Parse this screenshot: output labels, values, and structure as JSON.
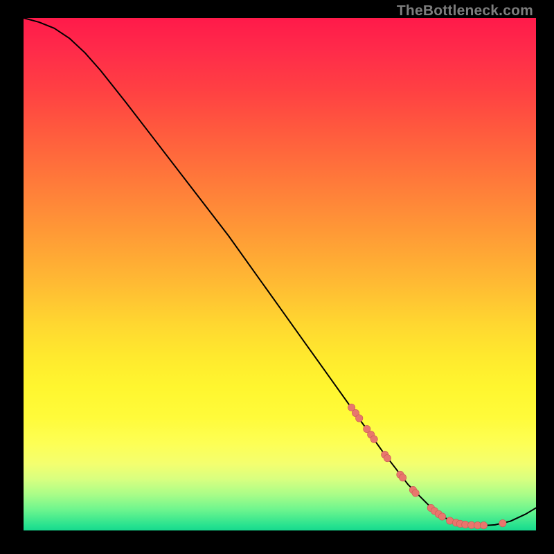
{
  "watermark": "TheBottleneck.com",
  "colors": {
    "curve_stroke": "#000000",
    "point_fill": "#e8766d",
    "point_stroke": "#c95a54"
  },
  "chart_data": {
    "type": "line",
    "title": "",
    "xlabel": "",
    "ylabel": "",
    "xlim": [
      0,
      100
    ],
    "ylim": [
      0,
      100
    ],
    "curve": [
      {
        "x": 0,
        "y": 100
      },
      {
        "x": 3,
        "y": 99.2
      },
      {
        "x": 6,
        "y": 98.0
      },
      {
        "x": 9,
        "y": 96.0
      },
      {
        "x": 12,
        "y": 93.2
      },
      {
        "x": 15,
        "y": 89.8
      },
      {
        "x": 20,
        "y": 83.5
      },
      {
        "x": 25,
        "y": 77.0
      },
      {
        "x": 30,
        "y": 70.5
      },
      {
        "x": 35,
        "y": 64.0
      },
      {
        "x": 40,
        "y": 57.5
      },
      {
        "x": 45,
        "y": 50.5
      },
      {
        "x": 50,
        "y": 43.5
      },
      {
        "x": 55,
        "y": 36.5
      },
      {
        "x": 60,
        "y": 29.5
      },
      {
        "x": 65,
        "y": 22.5
      },
      {
        "x": 70,
        "y": 15.5
      },
      {
        "x": 75,
        "y": 9.0
      },
      {
        "x": 80,
        "y": 4.0
      },
      {
        "x": 83,
        "y": 2.0
      },
      {
        "x": 86,
        "y": 1.1
      },
      {
        "x": 89,
        "y": 0.9
      },
      {
        "x": 92,
        "y": 1.1
      },
      {
        "x": 95,
        "y": 1.8
      },
      {
        "x": 98,
        "y": 3.2
      },
      {
        "x": 100,
        "y": 4.4
      }
    ],
    "points": [
      {
        "x": 64.0,
        "y": 24.0
      },
      {
        "x": 64.8,
        "y": 22.9
      },
      {
        "x": 65.5,
        "y": 21.9
      },
      {
        "x": 67.0,
        "y": 19.8
      },
      {
        "x": 67.8,
        "y": 18.7
      },
      {
        "x": 68.4,
        "y": 17.8
      },
      {
        "x": 70.5,
        "y": 14.8
      },
      {
        "x": 71.0,
        "y": 14.1
      },
      {
        "x": 73.5,
        "y": 10.9
      },
      {
        "x": 74.0,
        "y": 10.3
      },
      {
        "x": 76.0,
        "y": 7.9
      },
      {
        "x": 76.5,
        "y": 7.3
      },
      {
        "x": 79.5,
        "y": 4.4
      },
      {
        "x": 80.2,
        "y": 3.8
      },
      {
        "x": 81.0,
        "y": 3.2
      },
      {
        "x": 81.7,
        "y": 2.7
      },
      {
        "x": 83.2,
        "y": 1.9
      },
      {
        "x": 84.4,
        "y": 1.5
      },
      {
        "x": 85.2,
        "y": 1.3
      },
      {
        "x": 86.2,
        "y": 1.15
      },
      {
        "x": 87.4,
        "y": 1.05
      },
      {
        "x": 88.6,
        "y": 1.0
      },
      {
        "x": 89.8,
        "y": 1.0
      },
      {
        "x": 93.5,
        "y": 1.4
      }
    ]
  }
}
